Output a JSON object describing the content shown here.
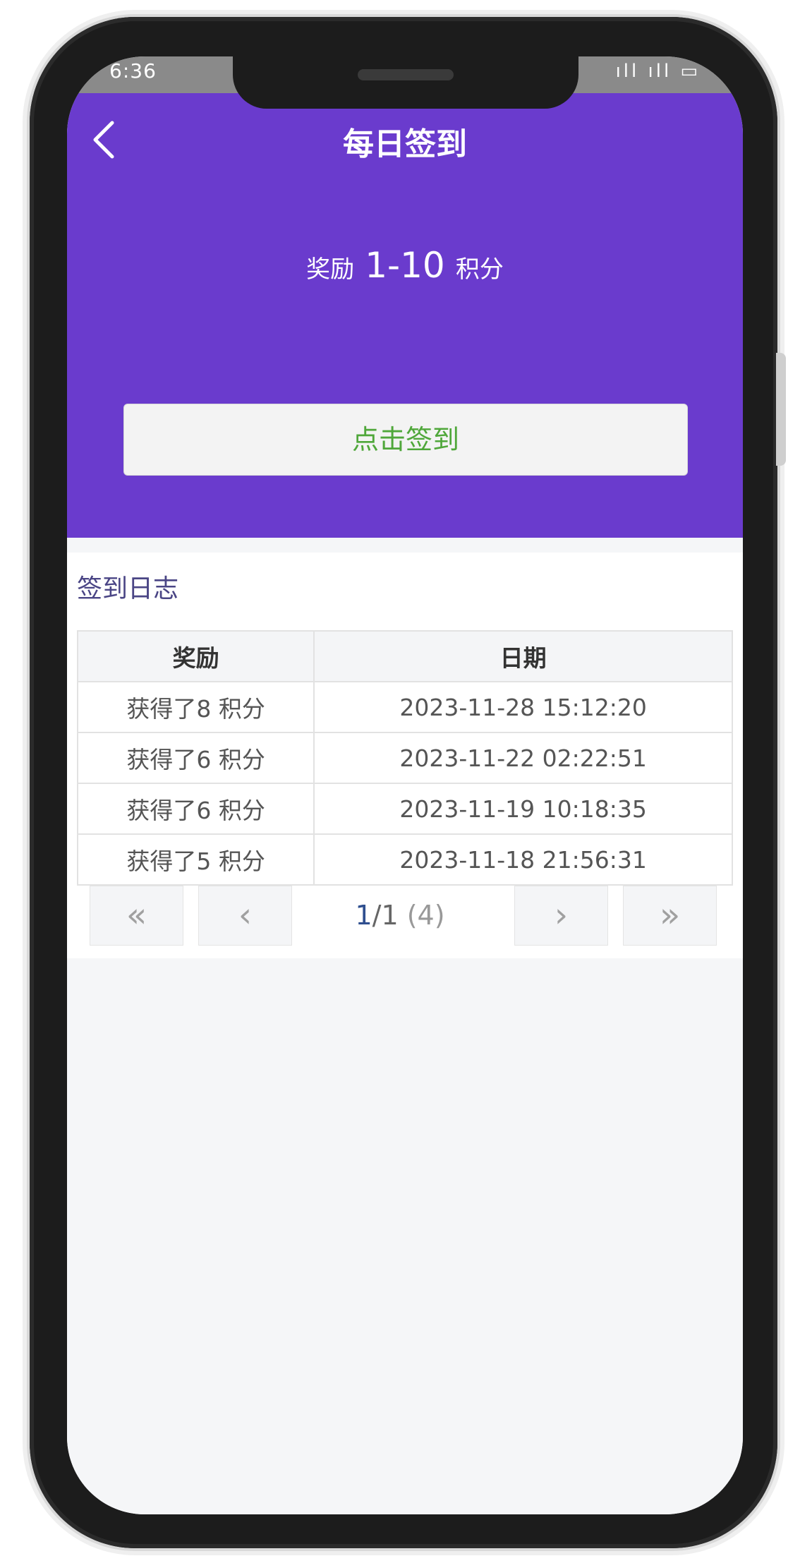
{
  "status_bar": {
    "time": "6:36",
    "icons": "ıll ıll ▭"
  },
  "header": {
    "title": "每日签到",
    "reward_prefix": "奖励",
    "reward_range": "1-10",
    "reward_suffix": "积分",
    "sign_button_label": "点击签到",
    "accent_color": "#6a3bcd",
    "button_text_color": "#4fa73a"
  },
  "log": {
    "section_title": "签到日志",
    "columns": [
      "奖励",
      "日期"
    ],
    "rows": [
      {
        "reward": "获得了8 积分",
        "date": "2023-11-28 15:12:20"
      },
      {
        "reward": "获得了6 积分",
        "date": "2023-11-22 02:22:51"
      },
      {
        "reward": "获得了6 积分",
        "date": "2023-11-19 10:18:35"
      },
      {
        "reward": "获得了5 积分",
        "date": "2023-11-18 21:56:31"
      }
    ]
  },
  "pager": {
    "first_icon": "«",
    "prev_icon": "‹",
    "next_icon": "›",
    "last_icon": "»",
    "current_page": "1",
    "separator": "/",
    "total_pages": "1",
    "total_count": "(4)"
  }
}
